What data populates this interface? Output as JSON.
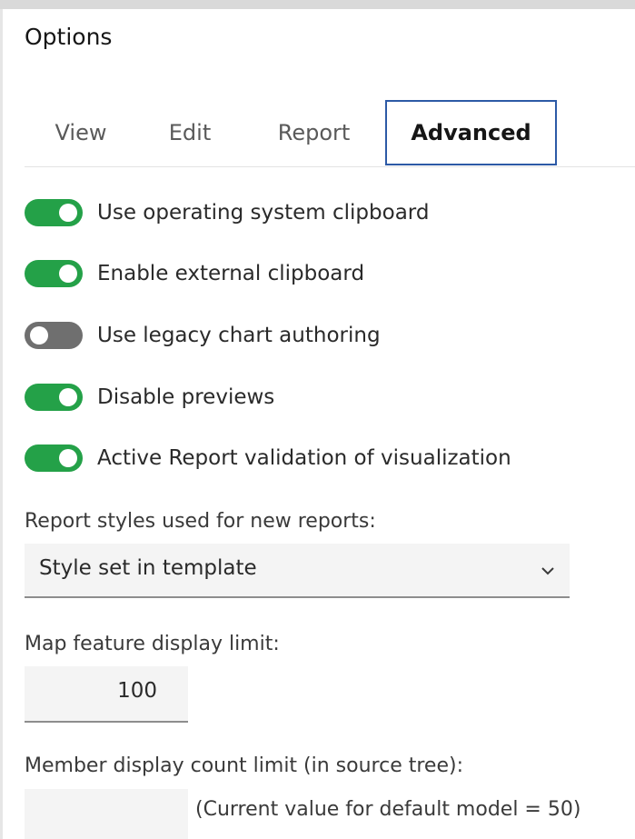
{
  "dialog": {
    "title": "Options"
  },
  "tabs": [
    {
      "label": "View",
      "active": false
    },
    {
      "label": "Edit",
      "active": false
    },
    {
      "label": "Report",
      "active": false
    },
    {
      "label": "Advanced",
      "active": true
    }
  ],
  "toggles": [
    {
      "label": "Use operating system clipboard",
      "on": true
    },
    {
      "label": "Enable external clipboard",
      "on": true
    },
    {
      "label": "Use legacy chart authoring",
      "on": false
    },
    {
      "label": "Disable previews",
      "on": true
    },
    {
      "label": "Active Report validation of visualization",
      "on": true
    }
  ],
  "report_styles": {
    "label": "Report styles used for new reports:",
    "selected": "Style set in template",
    "icon": "chevron-down-icon"
  },
  "map_limit": {
    "label": "Map feature display limit:",
    "value": "100"
  },
  "member_limit": {
    "label": "Member display count limit (in source tree):",
    "value": "",
    "hint": "(Current value for default model = 50)"
  },
  "colors": {
    "toggle_on": "#24a148",
    "toggle_off": "#6f6f6f",
    "active_tab_border": "#2d5aa6"
  }
}
